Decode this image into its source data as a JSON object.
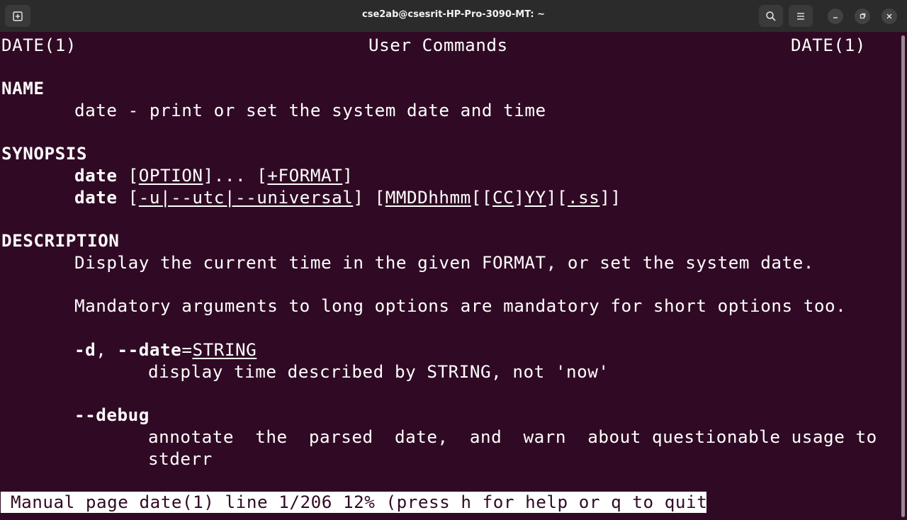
{
  "window": {
    "title": "cse2ab@csesrit-HP-Pro-3090-MT: ~",
    "icons": [
      "new-tab-icon",
      "search-icon",
      "hamburger-menu-icon",
      "minimize-icon",
      "maximize-icon",
      "close-icon"
    ]
  },
  "man": {
    "header_left": "DATE(1)",
    "header_center": "User Commands",
    "header_right": "DATE(1)",
    "name_heading": "NAME",
    "name_desc": "date - print or set the system date and time",
    "synopsis_heading": "SYNOPSIS",
    "syn1_cmd": "date",
    "syn1_b1": "[",
    "syn1_opt": "OPTION",
    "syn1_b2": "]... [",
    "syn1_fmt": "+FORMAT",
    "syn1_b3": "]",
    "syn2_cmd": "date",
    "syn2_b1": "[",
    "syn2_u": "-u|--utc|--universal",
    "syn2_b2": "] [",
    "syn2_m": "MMDDhhmm",
    "syn2_b3": "[[",
    "syn2_cc": "CC",
    "syn2_b4": "]",
    "syn2_yy": "YY",
    "syn2_b5": "][",
    "syn2_ss": ".ss",
    "syn2_b6": "]]",
    "description_heading": "DESCRIPTION",
    "desc1": "Display the current time in the given FORMAT, or set the system date.",
    "desc2": "Mandatory arguments to long options are mandatory for short options too.",
    "opt_d": "-d",
    "opt_d_sep": ", ",
    "opt_date": "--date",
    "opt_eq": "=",
    "opt_string": "STRING",
    "opt_d_desc": "display time described by STRING, not 'now'",
    "opt_debug": "--debug",
    "opt_debug_desc1": "annotate  the  parsed  date,  and  warn  about questionable usage to",
    "opt_debug_desc2": "stderr"
  },
  "status_line": "Manual page date(1) line 1/206 12% (press h for help or q to quit)",
  "colors": {
    "terminal_bg": "#300a24",
    "titlebar_bg": "#2b2b2b",
    "text": "#ffffff"
  }
}
